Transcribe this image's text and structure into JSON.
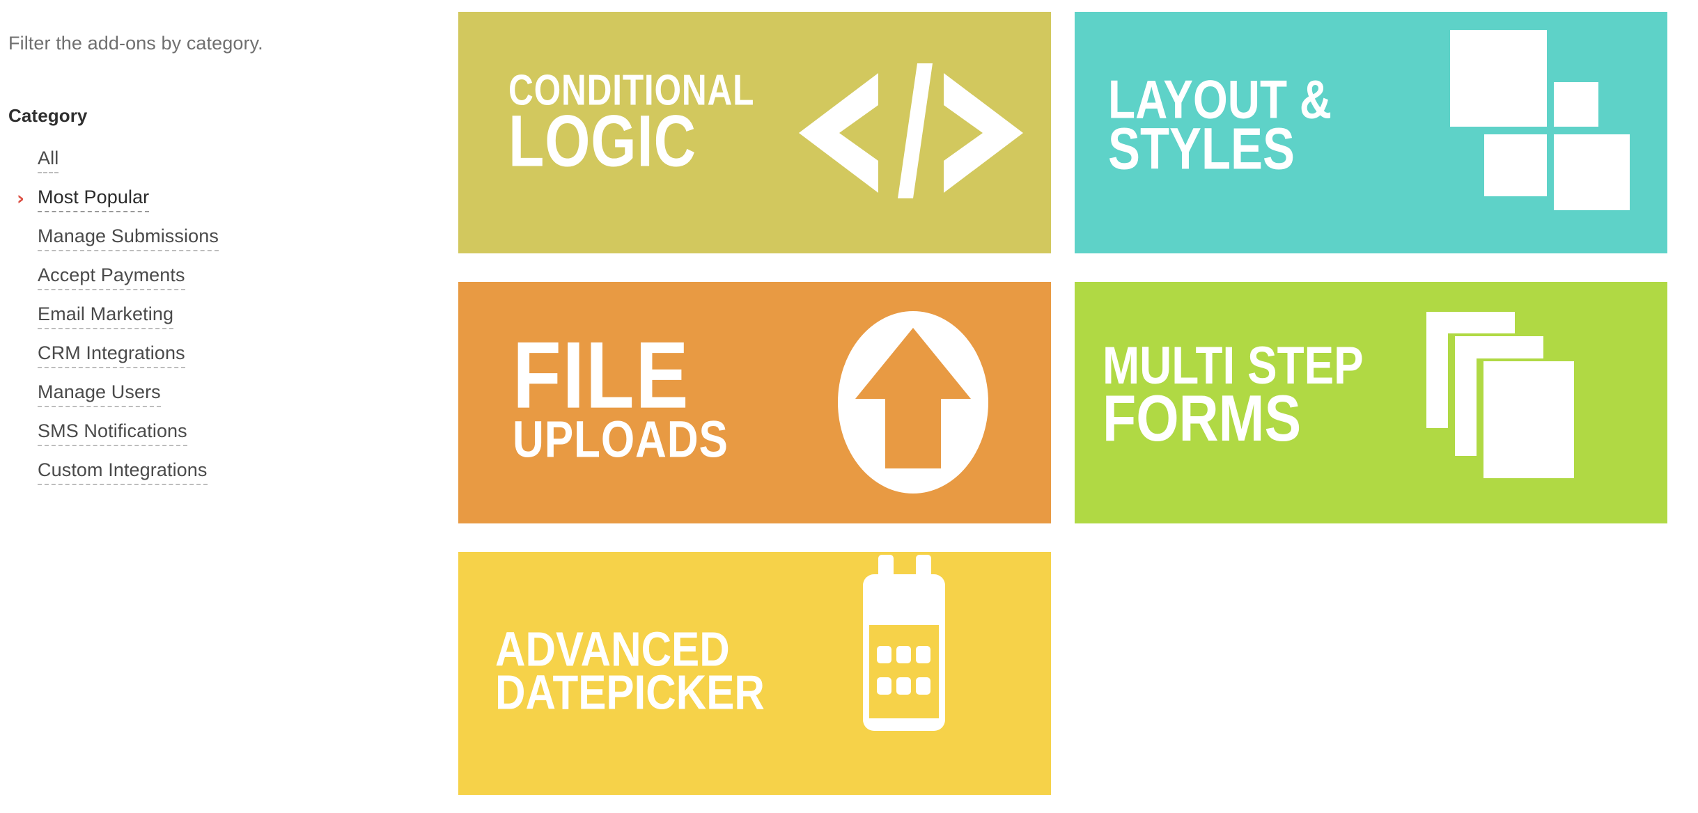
{
  "sidebar": {
    "description": "Filter the add-ons by category.",
    "heading": "Category",
    "active_index": 1,
    "chevron_glyph": "›",
    "chevron_color": "#dc4e42",
    "items": [
      {
        "label": "All"
      },
      {
        "label": "Most Popular"
      },
      {
        "label": "Manage Submissions"
      },
      {
        "label": "Accept Payments"
      },
      {
        "label": "Email Marketing"
      },
      {
        "label": "CRM Integrations"
      },
      {
        "label": "Manage Users"
      },
      {
        "label": "SMS Notifications"
      },
      {
        "label": "Custom Integrations"
      }
    ]
  },
  "cards": [
    {
      "id": "conditional-logic",
      "line1": "CONDITIONAL",
      "line2": "LOGIC",
      "color": "#d2c85e",
      "icon": "code-brackets-icon"
    },
    {
      "id": "layout-styles",
      "line1": "LAYOUT &",
      "line2": "STYLES",
      "color": "#5ed2c8",
      "icon": "layout-blocks-icon"
    },
    {
      "id": "file-uploads",
      "line1": "FILE",
      "line2": "UPLOADS",
      "color": "#e89a43",
      "icon": "upload-arrow-circle-icon"
    },
    {
      "id": "multi-step-forms",
      "line1": "MULTI STEP",
      "line2": "FORMS",
      "color": "#b0d944",
      "icon": "stacked-pages-icon"
    },
    {
      "id": "advanced-datepicker",
      "line1": "ADVANCED",
      "line2": "DATEPICKER",
      "color": "#f6d249",
      "icon": "calendar-icon"
    }
  ]
}
